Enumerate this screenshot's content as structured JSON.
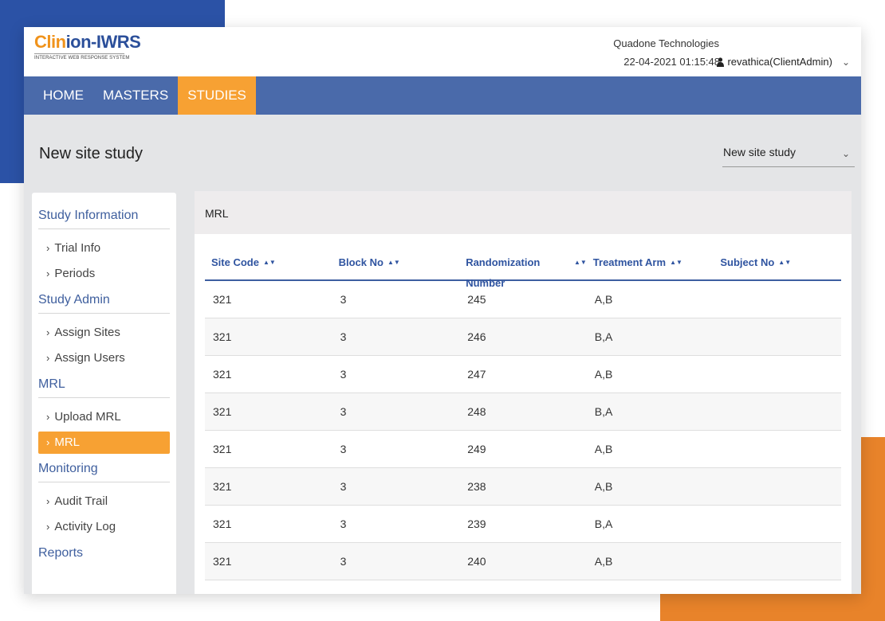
{
  "header": {
    "logo_part1": "Clin",
    "logo_part2": "ion-IWRS",
    "logo_tagline": "INTERACTIVE WEB RESPONSE SYSTEM",
    "company": "Quadone Technologies",
    "datetime": "22-04-2021 01:15:48",
    "user": "revathica(ClientAdmin)"
  },
  "nav": [
    {
      "label": "HOME"
    },
    {
      "label": "MASTERS"
    },
    {
      "label": "STUDIES"
    }
  ],
  "page": {
    "title": "New site study",
    "study_select": "New site study"
  },
  "sidebar": {
    "sections": [
      {
        "title": "Study Information",
        "items": [
          "Trial Info",
          "Periods"
        ]
      },
      {
        "title": "Study Admin",
        "items": [
          "Assign Sites",
          "Assign Users"
        ]
      },
      {
        "title": "MRL",
        "items": [
          "Upload MRL",
          "MRL"
        ]
      },
      {
        "title": "Monitoring",
        "items": [
          "Audit Trail",
          "Activity Log"
        ]
      },
      {
        "title": "Reports",
        "items": []
      }
    ],
    "active_item": "MRL"
  },
  "panel": {
    "title": "MRL",
    "columns": [
      "Site Code",
      "Block No",
      "Randomization Number",
      "Treatment Arm",
      "Subject No"
    ],
    "rows": [
      [
        "321",
        "3",
        "245",
        "A,B",
        ""
      ],
      [
        "321",
        "3",
        "246",
        "B,A",
        ""
      ],
      [
        "321",
        "3",
        "247",
        "A,B",
        ""
      ],
      [
        "321",
        "3",
        "248",
        "B,A",
        ""
      ],
      [
        "321",
        "3",
        "249",
        "A,B",
        ""
      ],
      [
        "321",
        "3",
        "238",
        "A,B",
        ""
      ],
      [
        "321",
        "3",
        "239",
        "B,A",
        ""
      ],
      [
        "321",
        "3",
        "240",
        "A,B",
        ""
      ]
    ]
  },
  "colors": {
    "nav_bg": "#4a6aaa",
    "accent": "#f7a133",
    "link": "#3f5f9e",
    "deco_blue": "#2b52a6",
    "deco_orange": "#e8832a"
  }
}
